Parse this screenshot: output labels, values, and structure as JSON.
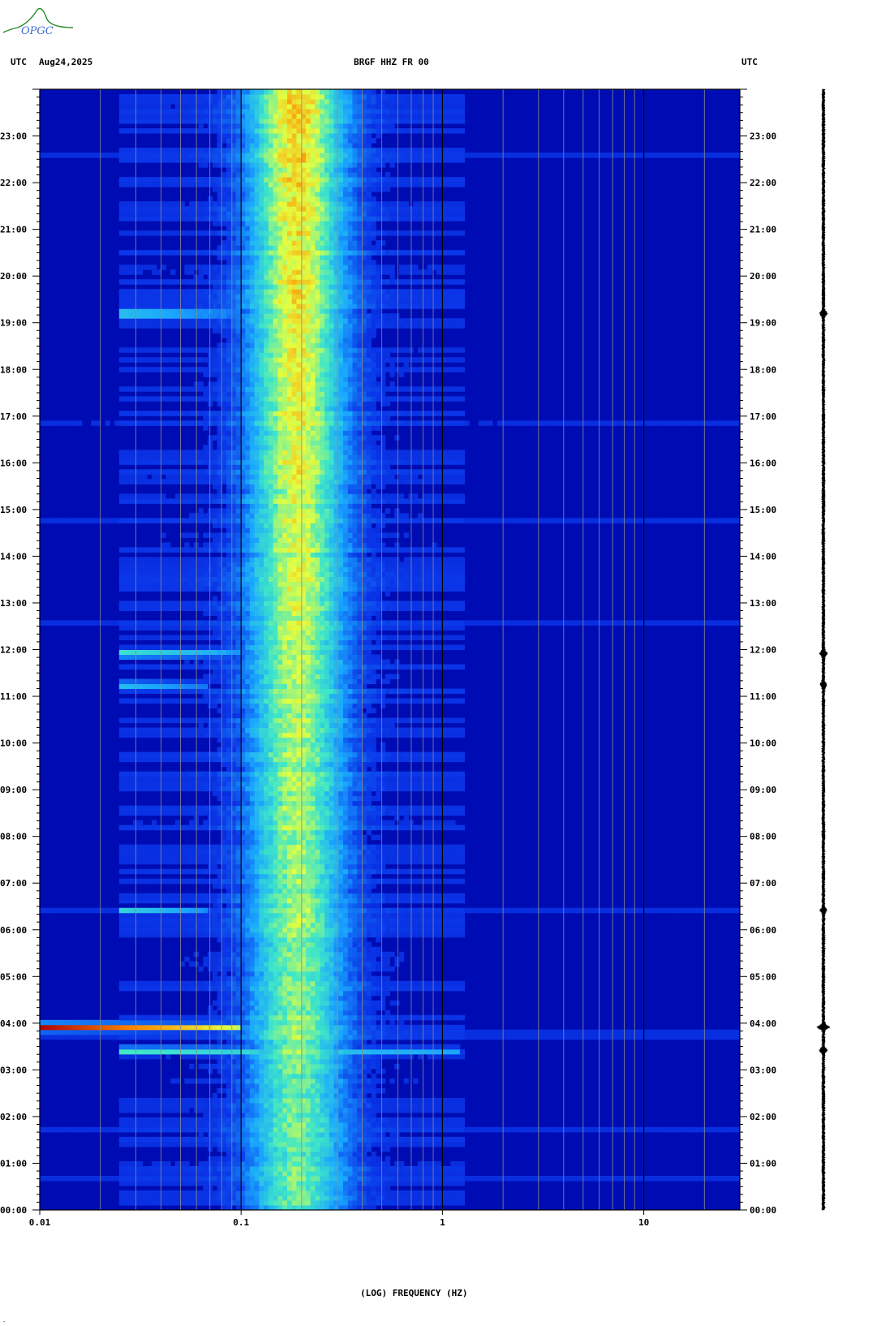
{
  "header": {
    "left_tz": "UTC",
    "date": "Aug24,2025",
    "station": "BRGF HHZ FR 00",
    "right_tz": "UTC"
  },
  "logo": {
    "name": "OPGC logo",
    "text": "OPGC"
  },
  "footer": {
    "mark": "·"
  },
  "chart_data": {
    "type": "heatmap",
    "title": "BRGF HHZ FR 00",
    "xlabel": "(LOG) FREQUENCY (HZ)",
    "x_scale": "log",
    "xlim": [
      0.01,
      30
    ],
    "x_ticks": [
      {
        "value": 0.01,
        "label": "0.01"
      },
      {
        "value": 0.1,
        "label": "0.1"
      },
      {
        "value": 1,
        "label": "1"
      },
      {
        "value": 10,
        "label": "10"
      }
    ],
    "ylim_hours": [
      0,
      24
    ],
    "y_ticks": [
      "00:00",
      "01:00",
      "02:00",
      "03:00",
      "04:00",
      "05:00",
      "06:00",
      "07:00",
      "08:00",
      "09:00",
      "10:00",
      "11:00",
      "12:00",
      "13:00",
      "14:00",
      "15:00",
      "16:00",
      "17:00",
      "18:00",
      "19:00",
      "20:00",
      "21:00",
      "22:00",
      "23:00"
    ],
    "colormap": [
      "#000bb0",
      "#0a35e8",
      "#1aa6ff",
      "#3fe6c8",
      "#e4ff40",
      "#ff8a00",
      "#b00000"
    ],
    "background_band": {
      "freq_range": [
        0.12,
        0.3
      ],
      "level": "strong",
      "note": "microseism band"
    },
    "events": [
      {
        "time": "03:55",
        "freq_range": [
          0.01,
          0.1
        ],
        "level": "very strong"
      },
      {
        "time": "03:25",
        "freq_range": [
          0.025,
          1.2
        ],
        "level": "moderate"
      },
      {
        "time": "19:12",
        "freq_range": [
          0.025,
          0.1
        ],
        "level": "moderate"
      },
      {
        "time": "11:55",
        "freq_range": [
          0.025,
          0.1
        ],
        "level": "moderate"
      },
      {
        "time": "06:25",
        "freq_range": [
          0.025,
          0.07
        ],
        "level": "weak"
      },
      {
        "time": "11:15",
        "freq_range": [
          0.025,
          0.07
        ],
        "level": "weak"
      }
    ],
    "colors": {
      "background": "#000cb3",
      "frame": "#000000",
      "gridline": "#8c8c8c"
    }
  }
}
